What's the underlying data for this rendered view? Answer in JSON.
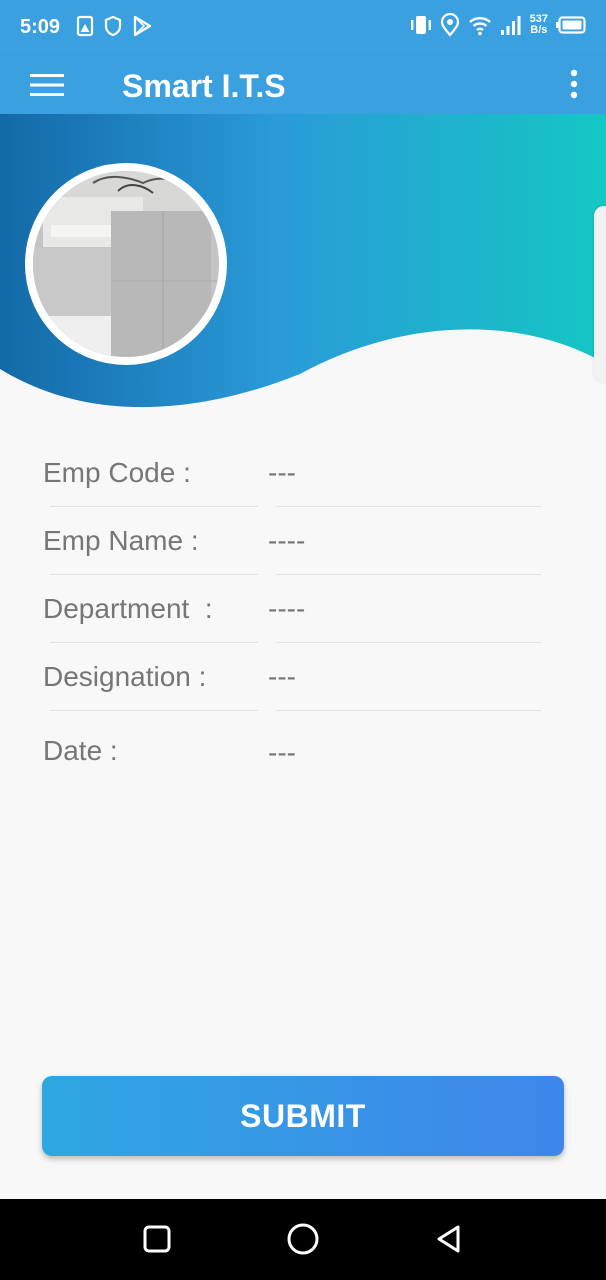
{
  "status_bar": {
    "time": "5:09",
    "net_speed_value": "537",
    "net_speed_unit": "B/s",
    "left_icons": [
      "gallery-notification-icon",
      "shield-icon",
      "play-store-icon"
    ],
    "right_icons": [
      "vibrate-icon",
      "location-icon",
      "wifi-icon",
      "signal-icon",
      "battery-icon"
    ]
  },
  "app_bar": {
    "title": "Smart I.T.S",
    "icons": [
      "hamburger-menu-icon",
      "more-vert-icon"
    ]
  },
  "header": {
    "gradient_colors": [
      "#1469a8",
      "#2a9ad8",
      "#15c7c4"
    ],
    "wave_fill": "#f8f8f9"
  },
  "form": {
    "rows": [
      {
        "label": "Emp Code :",
        "value": "---"
      },
      {
        "label": "Emp Name :",
        "value": "----"
      },
      {
        "label": "Department  :",
        "value": "----"
      },
      {
        "label": "Designation :",
        "value": "---"
      },
      {
        "label": "Date :",
        "value": "---"
      }
    ]
  },
  "submit": {
    "label": "SUBMIT"
  },
  "nav_bar": {
    "icons": [
      "recents-square-icon",
      "home-circle-icon",
      "back-triangle-icon"
    ]
  },
  "colors": {
    "app_bar": "#3aa0df",
    "text_gray": "#767676",
    "button_start": "#2ea7e2",
    "button_end": "#3f86ea",
    "background": "#f8f8f9"
  }
}
